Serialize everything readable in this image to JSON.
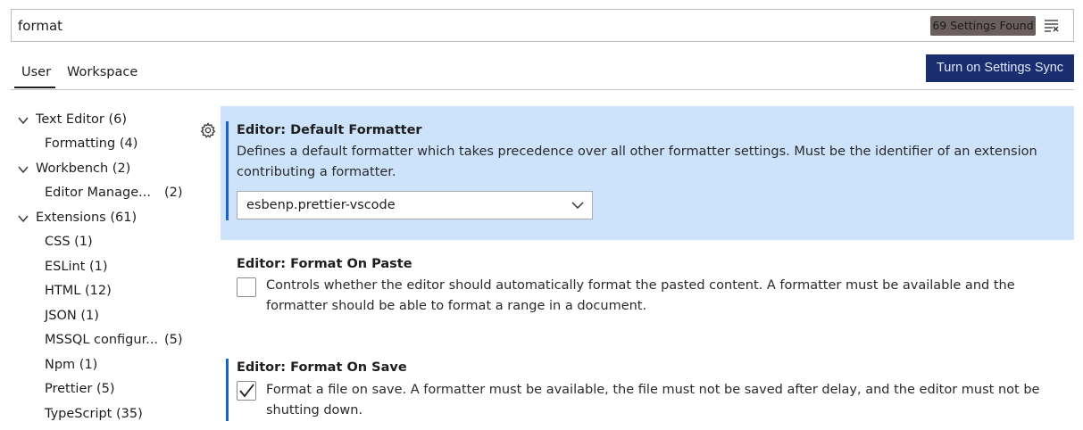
{
  "search": {
    "value": "format",
    "results_badge": "69 Settings Found"
  },
  "tabs": {
    "user": "User",
    "workspace": "Workspace"
  },
  "sync_button": "Turn on Settings Sync",
  "toc": [
    {
      "label": "Text Editor (6)",
      "count": ""
    },
    {
      "label": "Formatting (4)",
      "count": ""
    },
    {
      "label": "Workbench (2)",
      "count": ""
    },
    {
      "label": "Editor Manage...",
      "count": "(2)"
    },
    {
      "label": "Extensions (61)",
      "count": ""
    },
    {
      "label": "CSS (1)",
      "count": ""
    },
    {
      "label": "ESLint (1)",
      "count": ""
    },
    {
      "label": "HTML (12)",
      "count": ""
    },
    {
      "label": "JSON (1)",
      "count": ""
    },
    {
      "label": "MSSQL configur...",
      "count": "(5)"
    },
    {
      "label": "Npm (1)",
      "count": ""
    },
    {
      "label": "Prettier (5)",
      "count": ""
    },
    {
      "label": "TypeScript (35)",
      "count": ""
    }
  ],
  "settings": {
    "default_formatter": {
      "title": "Editor: Default Formatter",
      "desc_line1": "Defines a default formatter which takes precedence over all other formatter settings. Must be the identifier of an extension",
      "desc_line2": "contributing a formatter.",
      "value": "esbenp.prettier-vscode"
    },
    "format_on_paste": {
      "title": "Editor: Format On Paste",
      "desc_line1": "Controls whether the editor should automatically format the pasted content. A formatter must be available and the",
      "desc_line2": "formatter should be able to format a range in a document.",
      "checked": false
    },
    "format_on_save": {
      "title": "Editor: Format On Save",
      "desc_line1": "Format a file on save. A formatter must be available, the file must not be saved after delay, and the editor must not be",
      "desc_line2": "shutting down.",
      "checked": true
    }
  },
  "colors": {
    "accent": "#1c62c9",
    "focused_background": "#cce3fb",
    "sync_button_bg": "#1a2d6e"
  }
}
